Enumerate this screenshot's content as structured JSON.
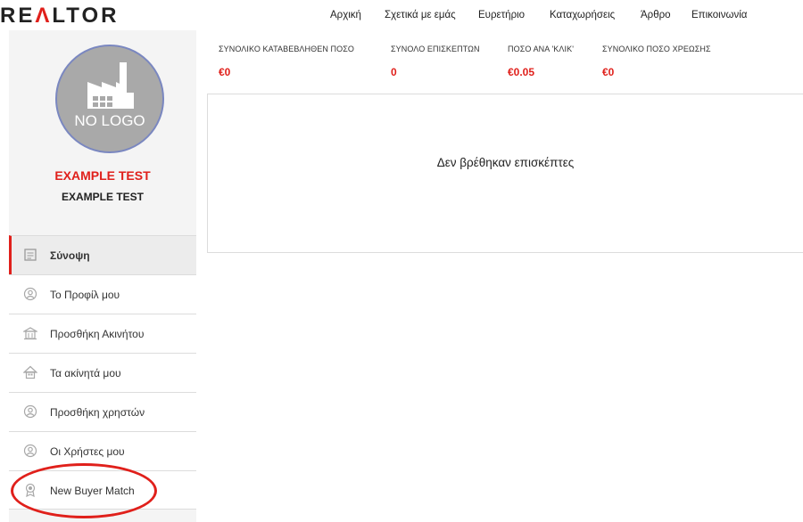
{
  "header": {
    "brand": "REALTOR",
    "nav": [
      "Αρχική",
      "Σχετικά με εμάς",
      "Ευρετήριο",
      "Καταχωρήσεις",
      "Άρθρο",
      "Επικοινωνία"
    ]
  },
  "profile": {
    "logo_placeholder": "NO LOGO",
    "company_name": "EXAMPLE TEST",
    "company_subname": "EXAMPLE TEST"
  },
  "menu": {
    "items": [
      {
        "label": "Σύνοψη",
        "icon": "summary-icon"
      },
      {
        "label": "Το Προφίλ μου",
        "icon": "user-icon"
      },
      {
        "label": "Προσθήκη Ακινήτου",
        "icon": "building-icon"
      },
      {
        "label": "Τα ακίνητά μου",
        "icon": "house-icon"
      },
      {
        "label": "Προσθήκη χρηστών",
        "icon": "user-icon"
      },
      {
        "label": "Οι Χρήστες μου",
        "icon": "user-icon"
      },
      {
        "label": "New Buyer Match",
        "icon": "award-icon"
      }
    ],
    "active_index": 0
  },
  "stats": [
    {
      "title": "ΣΥΝΟΛΙΚΟ ΚΑΤΑΒΕΒΛΗΘΕΝ ΠΟΣΟ",
      "value": "€0"
    },
    {
      "title": "ΣΥΝΟΛΟ ΕΠΙΣΚΕΠΤΩΝ",
      "value": "0"
    },
    {
      "title": "ΠΟΣΟ ΑΝΑ 'ΚΛΙΚ'",
      "value": "€0.05"
    },
    {
      "title": "ΣΥΝΟΛΙΚΟ ΠΟΣΟ ΧΡΕΩΣΗΣ",
      "value": "€0"
    }
  ],
  "main": {
    "empty_message": "Δεν βρέθηκαν επισκέπτες"
  },
  "colors": {
    "accent": "#e0201b",
    "sidebar_bg": "#f4f4f4",
    "logo_bg": "#a9a9a9",
    "logo_border": "#7a87c0"
  }
}
